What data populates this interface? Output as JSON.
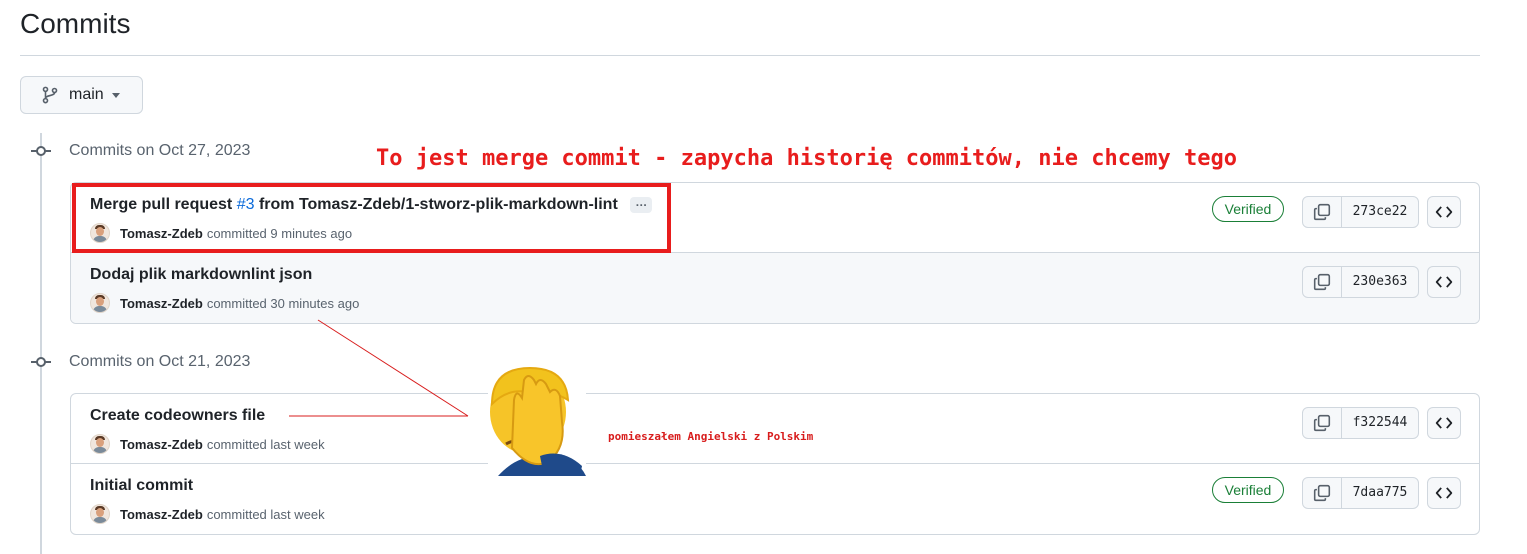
{
  "page": {
    "title": "Commits"
  },
  "branch": {
    "label": "main"
  },
  "groups": [
    {
      "heading": "Commits on Oct 27, 2023",
      "commits": [
        {
          "title_before": "Merge pull request ",
          "pr_link": "#3",
          "title_after": " from Tomasz-Zdeb/1-stworz-plik-markdown-lint",
          "ellipsis": "…",
          "author": "Tomasz-Zdeb",
          "time": "committed 9 minutes ago",
          "verified": "Verified",
          "sha": "273ce22"
        },
        {
          "title": "Dodaj plik markdownlint json",
          "author": "Tomasz-Zdeb",
          "time": "committed 30 minutes ago",
          "sha": "230e363"
        }
      ]
    },
    {
      "heading": "Commits on Oct 21, 2023",
      "commits": [
        {
          "title": "Create codeowners file",
          "author": "Tomasz-Zdeb",
          "time": "committed last week",
          "sha": "f322544"
        },
        {
          "title": "Initial commit",
          "author": "Tomasz-Zdeb",
          "time": "committed last week",
          "verified": "Verified",
          "sha": "7daa775"
        }
      ]
    }
  ],
  "annotations": {
    "main": "To jest merge commit - zapycha historię commitów, nie chcemy tego",
    "facepalm_caption": "pomieszałem Angielski z Polskim",
    "facepalm_icon": "face-palm-emoji",
    "color": "#e81d1d"
  },
  "icons": {
    "branch": "git-branch-icon",
    "copy": "copy-icon",
    "browse": "code-brackets-icon",
    "avatar": "user-avatar"
  }
}
